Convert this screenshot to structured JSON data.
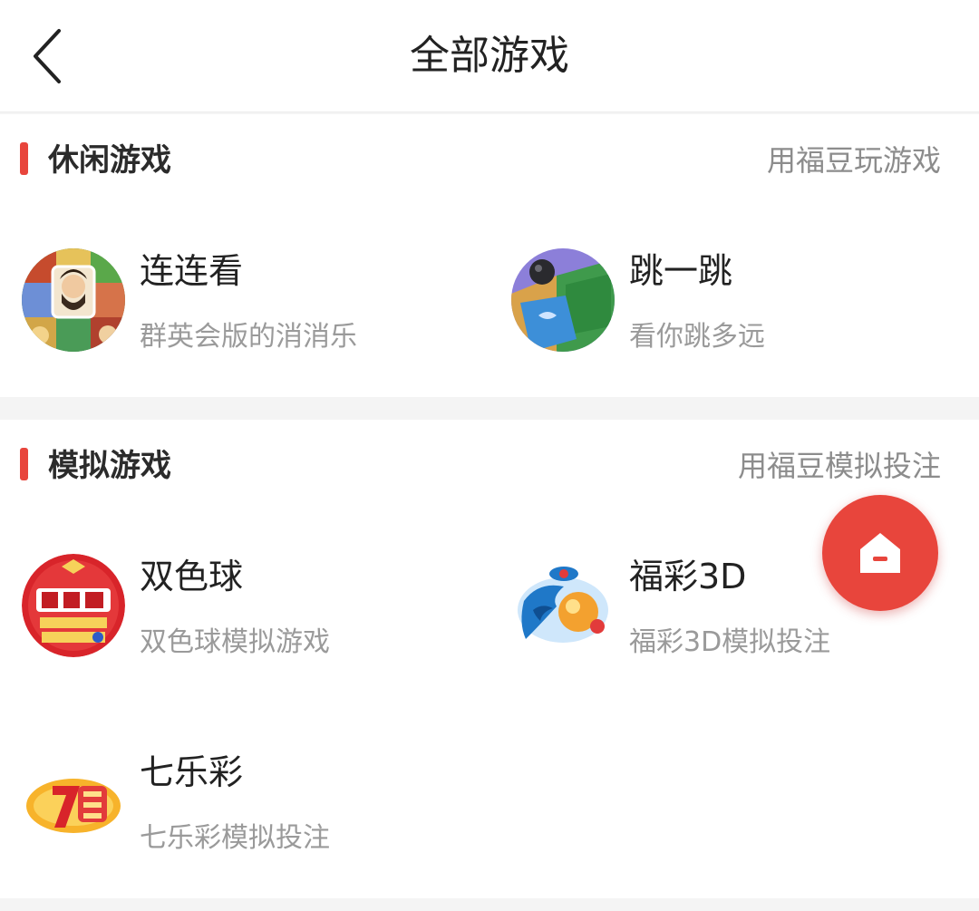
{
  "header": {
    "title": "全部游戏"
  },
  "sections": [
    {
      "title": "休闲游戏",
      "link": "用福豆玩游戏",
      "games": [
        {
          "name": "连连看",
          "desc": "群英会版的消消乐",
          "icon": "lianliankan-game-icon"
        },
        {
          "name": "跳一跳",
          "desc": "看你跳多远",
          "icon": "tiaoyitiao-game-icon"
        }
      ]
    },
    {
      "title": "模拟游戏",
      "link": "用福豆模拟投注",
      "games": [
        {
          "name": "双色球",
          "desc": "双色球模拟游戏",
          "icon": "shuangseqiu-lottery-icon"
        },
        {
          "name": "福彩3D",
          "desc": "福彩3D模拟投注",
          "icon": "fucai-3d-lottery-icon"
        },
        {
          "name": "七乐彩",
          "desc": "七乐彩模拟投注",
          "icon": "qilecai-lottery-icon"
        }
      ]
    }
  ],
  "floating_button": {
    "icon": "home-icon"
  },
  "colors": {
    "accent": "#e8453c",
    "title_text": "#222222",
    "secondary_text": "#9a9a9a",
    "background": "#f4f4f4"
  }
}
